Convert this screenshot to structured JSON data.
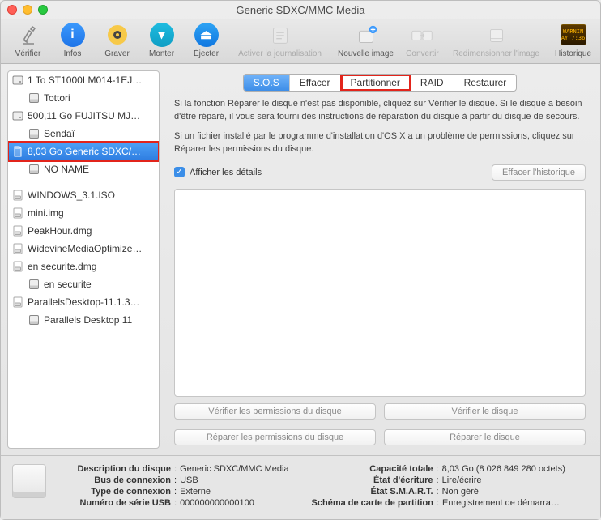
{
  "window": {
    "title": "Generic SDXC/MMC Media"
  },
  "toolbar": {
    "verify": "Vérifier",
    "info": "Infos",
    "burn": "Graver",
    "mount": "Monter",
    "eject": "Éjecter",
    "journal": "Activer la journalisation",
    "newimage": "Nouvelle image",
    "convert": "Convertir",
    "resize": "Redimensionner l'image",
    "history": "Historique",
    "hist_warn": "WARNIN",
    "hist_time": "AY 7:36"
  },
  "sidebar": {
    "items": [
      {
        "label": "1 To ST1000LM014-1EJ…",
        "icon": "hdd"
      },
      {
        "label": "Tottori",
        "icon": "vol",
        "indent": true
      },
      {
        "label": "500,11 Go FUJITSU MJ…",
        "icon": "hdd"
      },
      {
        "label": "Sendaï",
        "icon": "vol",
        "indent": true
      },
      {
        "label": "8,03 Go Generic SDXC/…",
        "icon": "sd",
        "selected": true,
        "highlight": true
      },
      {
        "label": "NO NAME",
        "icon": "vol",
        "indent": true
      }
    ],
    "files": [
      {
        "label": "WINDOWS_3.1.ISO",
        "icon": "dmg"
      },
      {
        "label": "mini.img",
        "icon": "dmg"
      },
      {
        "label": "PeakHour.dmg",
        "icon": "dmg"
      },
      {
        "label": "WidevineMediaOptimize…",
        "icon": "dmg"
      },
      {
        "label": "en securite.dmg",
        "icon": "dmg"
      },
      {
        "label": "en securite",
        "icon": "vol",
        "indent": true
      },
      {
        "label": "ParallelsDesktop-11.1.3…",
        "icon": "dmg"
      },
      {
        "label": "Parallels Desktop 11",
        "icon": "vol",
        "indent": true
      }
    ]
  },
  "tabs": {
    "sos": "S.O.S",
    "erase": "Effacer",
    "partition": "Partitionner",
    "raid": "RAID",
    "restore": "Restaurer"
  },
  "text": {
    "para1": "Si la fonction Réparer le disque n'est pas disponible, cliquez sur Vérifier le disque. Si le disque a besoin d'être réparé, il vous sera fourni des instructions de réparation du disque à partir du disque de secours.",
    "para2": "Si un fichier installé par le programme d'installation d'OS X a un problème de permissions, cliquez sur Réparer les permissions du disque.",
    "show_details": "Afficher les détails",
    "clear_history": "Effacer l'historique",
    "verify_perm": "Vérifier les permissions du disque",
    "repair_perm": "Réparer les permissions du disque",
    "verify_disk": "Vérifier le disque",
    "repair_disk": "Réparer le disque"
  },
  "footer": {
    "l1k": "Description du disque",
    "l1v": "Generic SDXC/MMC Media",
    "l2k": "Bus de connexion",
    "l2v": "USB",
    "l3k": "Type de connexion",
    "l3v": "Externe",
    "l4k": "Numéro de série USB",
    "l4v": "000000000000100",
    "r1k": "Capacité totale",
    "r1v": "8,03 Go (8 026 849 280 octets)",
    "r2k": "État d'écriture",
    "r2v": "Lire/écrire",
    "r3k": "État S.M.A.R.T.",
    "r3v": "Non géré",
    "r4k": "Schéma de carte de partition",
    "r4v": "Enregistrement de démarrage pri…"
  }
}
